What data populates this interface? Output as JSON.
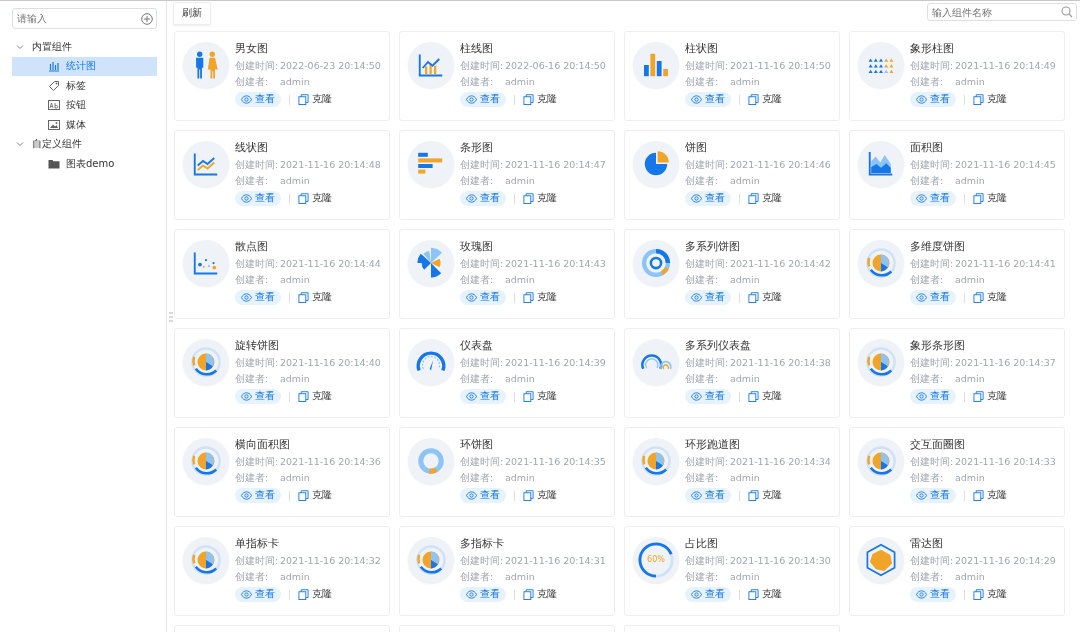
{
  "sidebar": {
    "search": {
      "placeholder": "请输入"
    },
    "tree": [
      {
        "label": "内置组件",
        "expanded": true,
        "children": [
          {
            "label": "统计图",
            "kind": "chart",
            "selected": true
          },
          {
            "label": "标签",
            "kind": "tag",
            "selected": false
          },
          {
            "label": "按钮",
            "kind": "button",
            "selected": false
          },
          {
            "label": "媒体",
            "kind": "image",
            "selected": false
          }
        ]
      },
      {
        "label": "自定义组件",
        "expanded": true,
        "children": [
          {
            "label": "图表demo",
            "kind": "folder",
            "selected": false
          }
        ]
      }
    ]
  },
  "toolbar": {
    "refresh": "刷新",
    "search": {
      "placeholder": "输入组件名称"
    }
  },
  "cards": [
    {
      "kind": "people",
      "title": "男女图",
      "time_label": "创建时间:",
      "time": "2022-06-23 20:14:50",
      "creator_label": "创建者:",
      "creator": "admin",
      "view": "查看",
      "clone": "克隆"
    },
    {
      "kind": "barline",
      "title": "柱线图",
      "time_label": "创建时间:",
      "time": "2022-06-16 20:14:50",
      "creator_label": "创建者:",
      "creator": "admin",
      "view": "查看",
      "clone": "克隆"
    },
    {
      "kind": "bar",
      "title": "柱状图",
      "time_label": "创建时间:",
      "time": "2021-11-16 20:14:50",
      "creator_label": "创建者:",
      "creator": "admin",
      "view": "查看",
      "clone": "克隆"
    },
    {
      "kind": "pictorial",
      "title": "象形柱图",
      "time_label": "创建时间:",
      "time": "2021-11-16 20:14:49",
      "creator_label": "创建者:",
      "creator": "admin",
      "view": "查看",
      "clone": "克隆"
    },
    {
      "kind": "line",
      "title": "线状图",
      "time_label": "创建时间:",
      "time": "2021-11-16 20:14:48",
      "creator_label": "创建者:",
      "creator": "admin",
      "view": "查看",
      "clone": "克隆"
    },
    {
      "kind": "hbar",
      "title": "条形图",
      "time_label": "创建时间:",
      "time": "2021-11-16 20:14:47",
      "creator_label": "创建者:",
      "creator": "admin",
      "view": "查看",
      "clone": "克隆"
    },
    {
      "kind": "pie",
      "title": "饼图",
      "time_label": "创建时间:",
      "time": "2021-11-16 20:14:46",
      "creator_label": "创建者:",
      "creator": "admin",
      "view": "查看",
      "clone": "克隆"
    },
    {
      "kind": "area",
      "title": "面积图",
      "time_label": "创建时间:",
      "time": "2021-11-16 20:14:45",
      "creator_label": "创建者:",
      "creator": "admin",
      "view": "查看",
      "clone": "克隆"
    },
    {
      "kind": "scatter",
      "title": "散点图",
      "time_label": "创建时间:",
      "time": "2021-11-16 20:14:44",
      "creator_label": "创建者:",
      "creator": "admin",
      "view": "查看",
      "clone": "克隆"
    },
    {
      "kind": "rose",
      "title": "玫瑰图",
      "time_label": "创建时间:",
      "time": "2021-11-16 20:14:43",
      "creator_label": "创建者:",
      "creator": "admin",
      "view": "查看",
      "clone": "克隆"
    },
    {
      "kind": "rings",
      "title": "多系列饼图",
      "time_label": "创建时间:",
      "time": "2021-11-16 20:14:42",
      "creator_label": "创建者:",
      "creator": "admin",
      "view": "查看",
      "clone": "克隆"
    },
    {
      "kind": "ringpie",
      "title": "多维度饼图",
      "time_label": "创建时间:",
      "time": "2021-11-16 20:14:41",
      "creator_label": "创建者:",
      "creator": "admin",
      "view": "查看",
      "clone": "克隆"
    },
    {
      "kind": "ringpie",
      "title": "旋转饼图",
      "time_label": "创建时间:",
      "time": "2021-11-16 20:14:40",
      "creator_label": "创建者:",
      "creator": "admin",
      "view": "查看",
      "clone": "克隆"
    },
    {
      "kind": "gauge",
      "title": "仪表盘",
      "time_label": "创建时间:",
      "time": "2021-11-16 20:14:39",
      "creator_label": "创建者:",
      "creator": "admin",
      "view": "查看",
      "clone": "克隆"
    },
    {
      "kind": "gauges",
      "title": "多系列仪表盘",
      "time_label": "创建时间:",
      "time": "2021-11-16 20:14:38",
      "creator_label": "创建者:",
      "creator": "admin",
      "view": "查看",
      "clone": "克隆"
    },
    {
      "kind": "ringpie",
      "title": "象形条形图",
      "time_label": "创建时间:",
      "time": "2021-11-16 20:14:37",
      "creator_label": "创建者:",
      "creator": "admin",
      "view": "查看",
      "clone": "克隆"
    },
    {
      "kind": "ringpie",
      "title": "横向面积图",
      "time_label": "创建时间:",
      "time": "2021-11-16 20:14:36",
      "creator_label": "创建者:",
      "creator": "admin",
      "view": "查看",
      "clone": "克隆"
    },
    {
      "kind": "donut",
      "title": "环饼图",
      "time_label": "创建时间:",
      "time": "2021-11-16 20:14:35",
      "creator_label": "创建者:",
      "creator": "admin",
      "view": "查看",
      "clone": "克隆"
    },
    {
      "kind": "ringpie",
      "title": "环形跑道图",
      "time_label": "创建时间:",
      "time": "2021-11-16 20:14:34",
      "creator_label": "创建者:",
      "creator": "admin",
      "view": "查看",
      "clone": "克隆"
    },
    {
      "kind": "ringpie",
      "title": "交互面圈图",
      "time_label": "创建时间:",
      "time": "2021-11-16 20:14:33",
      "creator_label": "创建者:",
      "creator": "admin",
      "view": "查看",
      "clone": "克隆"
    },
    {
      "kind": "ringpie",
      "title": "单指标卡",
      "time_label": "创建时间:",
      "time": "2021-11-16 20:14:32",
      "creator_label": "创建者:",
      "creator": "admin",
      "view": "查看",
      "clone": "克隆"
    },
    {
      "kind": "ringpie",
      "title": "多指标卡",
      "time_label": "创建时间:",
      "time": "2021-11-16 20:14:31",
      "creator_label": "创建者:",
      "creator": "admin",
      "view": "查看",
      "clone": "克隆"
    },
    {
      "kind": "progress",
      "icon_text": "60%",
      "title": "占比图",
      "time_label": "创建时间:",
      "time": "2021-11-16 20:14:30",
      "creator_label": "创建者:",
      "creator": "admin",
      "view": "查看",
      "clone": "克隆"
    },
    {
      "kind": "radar",
      "title": "雷达图",
      "time_label": "创建时间:",
      "time": "2021-11-16 20:14:29",
      "creator_label": "创建者:",
      "creator": "admin",
      "view": "查看",
      "clone": "克隆"
    },
    {
      "kind": "cut"
    },
    {
      "kind": "cut"
    },
    {
      "kind": "cut"
    }
  ]
}
